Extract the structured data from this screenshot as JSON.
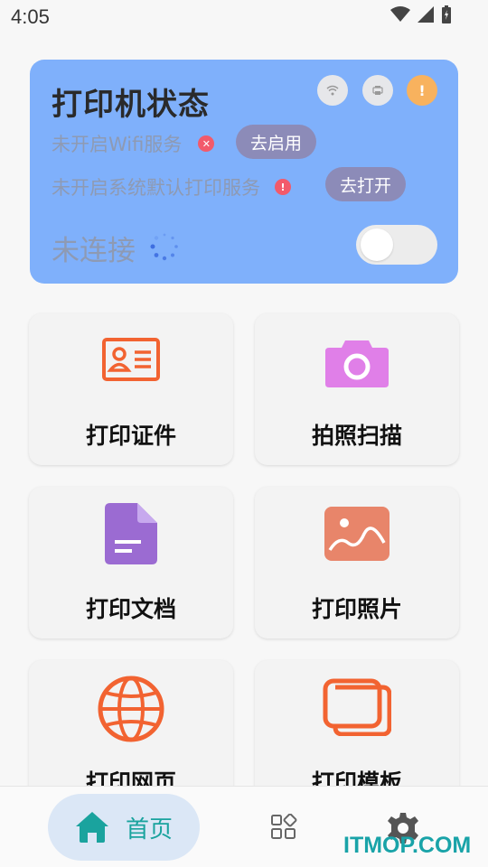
{
  "status_bar": {
    "time": "4:05"
  },
  "printer_card": {
    "title": "打印机状态",
    "wifi_status_text": "未开启Wifi服务",
    "wifi_button": "去启用",
    "print_service_text": "未开启系统默认打印服务",
    "print_service_button": "去打开",
    "warn_glyph": "!",
    "err_glyph_x": "✕",
    "err_glyph_excl": "!",
    "connection_text": "未连接"
  },
  "tiles": [
    {
      "label": "打印证件",
      "icon": "id-card-icon"
    },
    {
      "label": "拍照扫描",
      "icon": "camera-icon"
    },
    {
      "label": "打印文档",
      "icon": "document-icon"
    },
    {
      "label": "打印照片",
      "icon": "photo-icon"
    },
    {
      "label": "打印网页",
      "icon": "globe-icon"
    },
    {
      "label": "打印模板",
      "icon": "template-icon"
    }
  ],
  "bottom_nav": {
    "home_label": "首页"
  },
  "watermark": "ITMOP.COM",
  "colors": {
    "card_bg": "#7fb0fb",
    "accent_teal": "#1aa39e",
    "orange": "#f26331",
    "purple": "#9b6bd2",
    "pink": "#e07fe8",
    "salmon": "#e8856a"
  }
}
